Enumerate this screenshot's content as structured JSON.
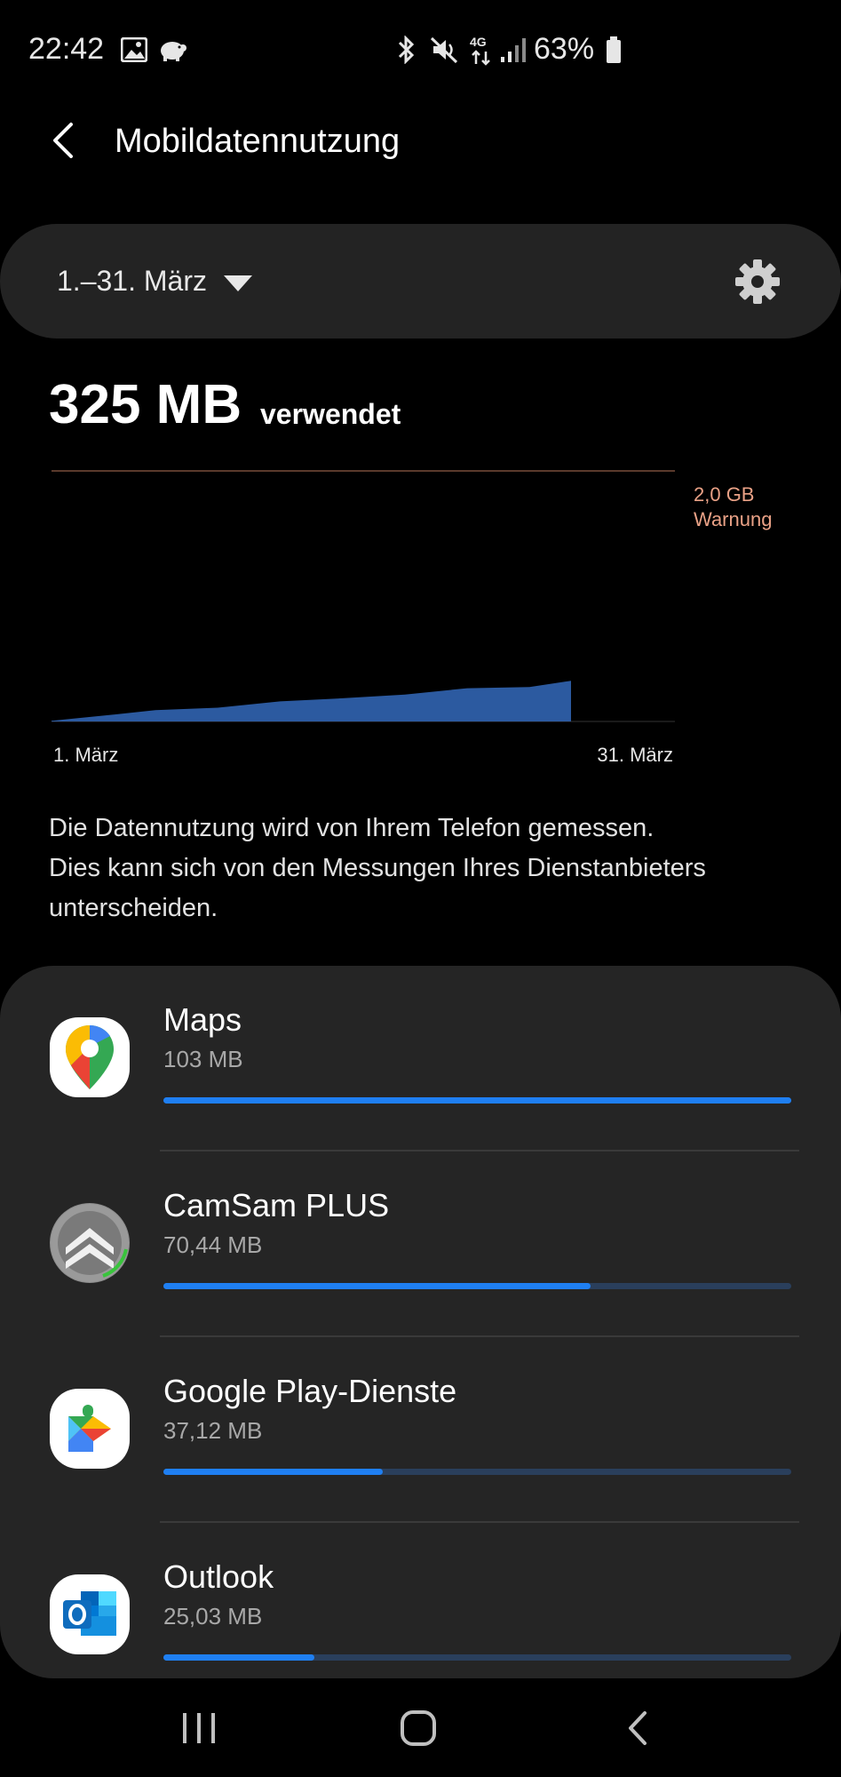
{
  "status_bar": {
    "time": "22:42",
    "battery_pct": "63%",
    "icons": [
      "gallery-icon",
      "piggy-bank-icon",
      "bluetooth-icon",
      "mute-icon",
      "4g-data-icon",
      "signal-icon",
      "battery-icon"
    ]
  },
  "header": {
    "title": "Mobildatennutzung"
  },
  "period": {
    "label": "1.–31. März"
  },
  "summary": {
    "amount": "325 MB",
    "suffix": "verwendet"
  },
  "chart_data": {
    "type": "area",
    "x_start_label": "1. März",
    "x_end_label": "31. März",
    "warning_value": "2,0 GB",
    "warning_label": "Warnung",
    "y_unit": "MB",
    "ylim": [
      0,
      2000
    ],
    "x": [
      1,
      4,
      6,
      9,
      12,
      15,
      18,
      21,
      24,
      26
    ],
    "values": [
      5,
      55,
      90,
      110,
      160,
      185,
      215,
      265,
      275,
      325
    ],
    "area_color": "#2c5aa0",
    "warning_color": "#e9a186"
  },
  "info_text": {
    "line1": "Die Datennutzung wird von Ihrem Telefon gemessen.",
    "line2": "Dies kann sich von den Messungen Ihres Dienstanbieters",
    "line3": "unterscheiden."
  },
  "apps": [
    {
      "name": "Maps",
      "size": "103 MB",
      "fraction": 1.0,
      "icon": "google-maps-icon"
    },
    {
      "name": "CamSam PLUS",
      "size": "70,44 MB",
      "fraction": 0.68,
      "icon": "camsam-icon"
    },
    {
      "name": "Google Play-Dienste",
      "size": "37,12 MB",
      "fraction": 0.35,
      "icon": "google-play-services-icon"
    },
    {
      "name": "Outlook",
      "size": "25,03 MB",
      "fraction": 0.24,
      "icon": "outlook-icon"
    }
  ],
  "colors": {
    "accent": "#1f7ff2",
    "bar_track": "#2a3f5c",
    "card_bg": "#252525"
  },
  "nav": {
    "icons": [
      "recents-icon",
      "home-icon",
      "back-icon"
    ]
  }
}
